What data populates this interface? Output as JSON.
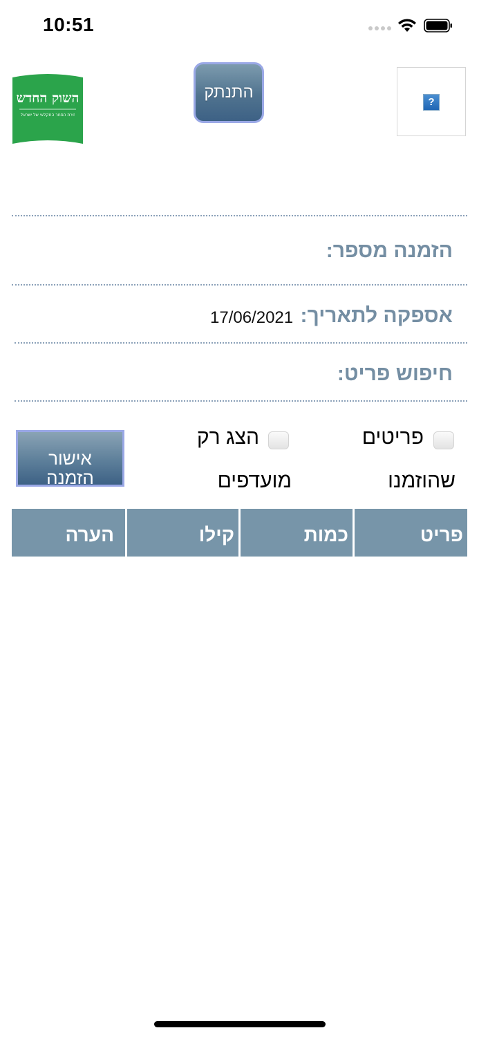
{
  "status_bar": {
    "time": "10:51"
  },
  "header": {
    "logo": {
      "title": "השוק החדש",
      "subtitle": "זירת הסחר החקלאי של ישראל",
      "color": "#2ba44b"
    },
    "logout_label": "התנתק",
    "image_placeholder_icon": "broken-image-icon"
  },
  "form": {
    "order_number_label": "הזמנה מספר:",
    "delivery_date_label": "אספקה לתאריך:",
    "delivery_date_value": "17/06/2021",
    "item_search_label": "חיפוש פריט:"
  },
  "filters": {
    "ordered_items": {
      "line1": "פריטים",
      "line2": "שהוזמנו"
    },
    "favorites_only": {
      "line1": "הצג רק",
      "line2": "מועדפים"
    }
  },
  "confirm_button": {
    "line1": "אישור",
    "line2": "הזמנה"
  },
  "table": {
    "headers": [
      "פריט",
      "כמות",
      "קילו",
      "הערה"
    ],
    "header_color": "#7795a9"
  },
  "colors": {
    "label": "#748ea3",
    "button_border": "#9aa8e6"
  }
}
